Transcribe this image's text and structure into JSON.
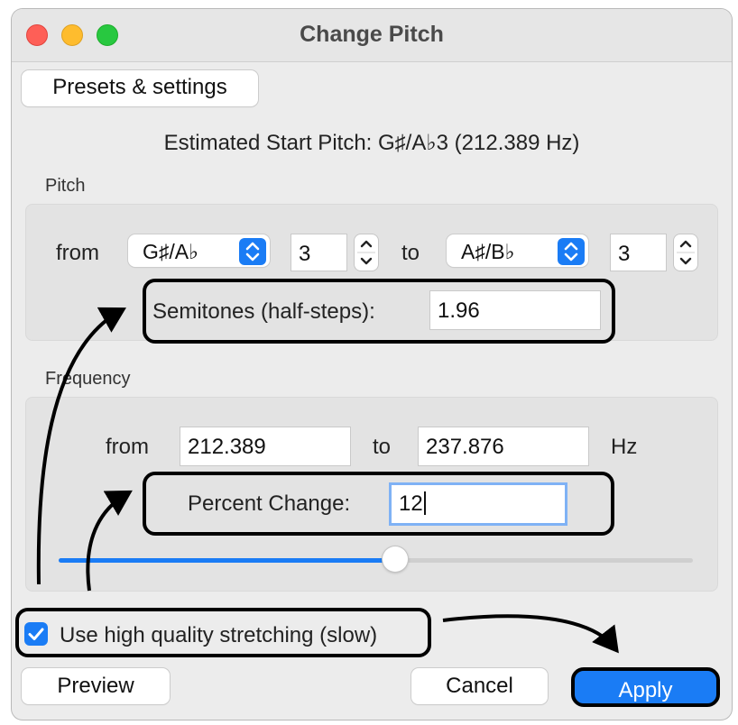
{
  "window": {
    "title": "Change Pitch"
  },
  "presets": {
    "label": "Presets & settings"
  },
  "estimate": {
    "text": "Estimated Start Pitch: G♯/A♭3 (212.389 Hz)"
  },
  "pitch": {
    "section_label": "Pitch",
    "from_label": "from",
    "from_note": "G♯/A♭",
    "from_octave": "3",
    "to_label": "to",
    "to_note": "A♯/B♭",
    "to_octave": "3",
    "semitones_label": "Semitones (half-steps):",
    "semitones_value": "1.96"
  },
  "frequency": {
    "section_label": "Frequency",
    "from_label": "from",
    "from_value": "212.389",
    "to_label": "to",
    "to_value": "237.876",
    "unit": "Hz",
    "percent_label": "Percent Change:",
    "percent_value": "12",
    "slider_level": 0.53
  },
  "options": {
    "high_quality_label": "Use high quality stretching (slow)",
    "high_quality_checked": true
  },
  "buttons": {
    "preview": "Preview",
    "cancel": "Cancel",
    "apply": "Apply"
  },
  "colors": {
    "accent": "#1a7cf5",
    "annotation": "#000000",
    "close": "#fe5f57",
    "minimize": "#febc2e",
    "maximize": "#28c840"
  }
}
